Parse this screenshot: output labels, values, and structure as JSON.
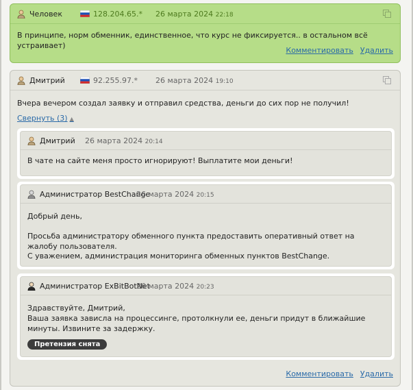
{
  "comments": [
    {
      "author": "Человек",
      "ip": "128.204.65.*",
      "date": "26 марта 2024",
      "time": "22:18",
      "text": "В принципе, норм обменник, единственное, что курс не фиксируется.. в остальном всё устраивает)",
      "comment_label": "Комментировать",
      "delete_label": "Удалить"
    },
    {
      "author": "Дмитрий",
      "ip": "92.255.97.*",
      "date": "26 марта 2024",
      "time": "19:10",
      "text": "Вчера вечером создал заявку и отправил средства, деньги до сих пор не получил!",
      "collapse_label": "Свернуть (3)",
      "comment_label": "Комментировать",
      "delete_label": "Удалить",
      "replies": [
        {
          "author": "Дмитрий",
          "date": "26 марта 2024",
          "time": "20:14",
          "lines": [
            "В чате на сайте меня просто игнорируют! Выплатите мои деньги!"
          ]
        },
        {
          "author": "Администратор BestChange",
          "date": "26 марта 2024",
          "time": "20:15",
          "lines": [
            "Добрый день,",
            "Просьба администратору обменного пункта предоставить оперативный ответ на жалобу пользователя.",
            "С уважением, администрация мониторинга обменных пунктов BestChange."
          ]
        },
        {
          "author": "Администратор ExBitBotNet",
          "date": "26 марта 2024",
          "time": "20:23",
          "lines": [
            "Здравствуйте, Дмитрий,",
            "Ваша заявка зависла на процессинге, протолкнули ее, деньги придут в ближайшие минуты. Извините за задержку."
          ],
          "badge": "Претензия снята"
        }
      ]
    }
  ],
  "icons": {
    "user": "user-icon",
    "admin": "admin-icon",
    "flag": "russia-flag-icon",
    "copy": "copy-icon"
  },
  "colors": {
    "green_card": "#b6dd88",
    "green_text": "#4d7a1e",
    "link": "#2a6aa8",
    "badge": "#3c3c3c"
  }
}
